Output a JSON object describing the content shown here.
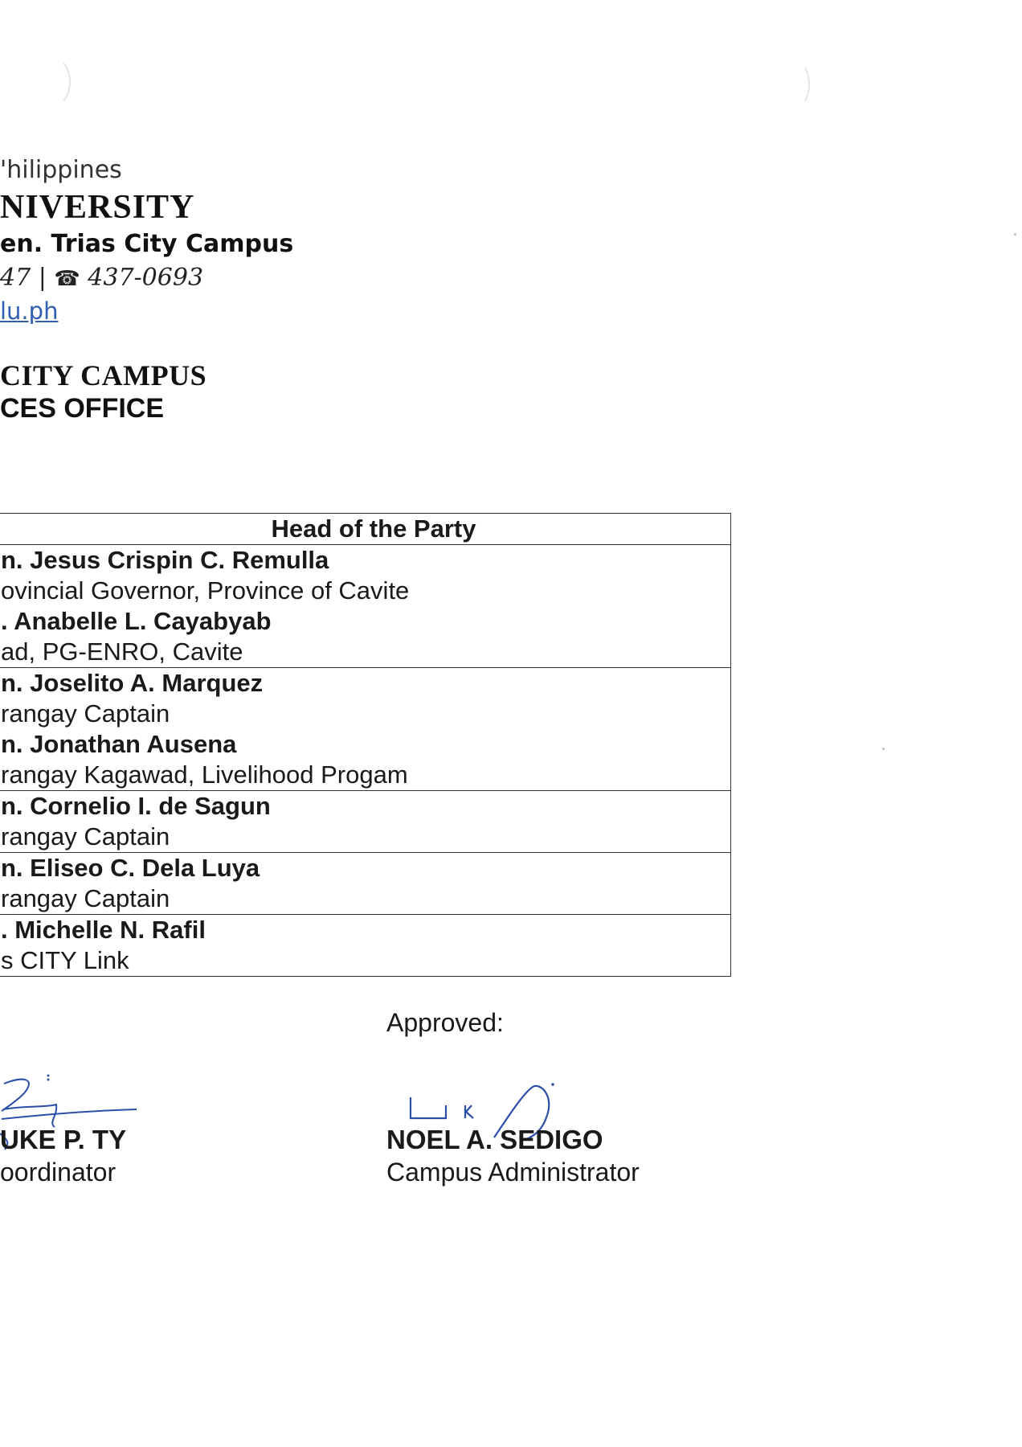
{
  "letterhead": {
    "country": "'hilippines",
    "university": "NIVERSITY",
    "campus": "en. Trias City Campus",
    "phone_left": "47 | ",
    "phone_right": " 437-0693",
    "phone_icon": "telephone-icon",
    "website": "lu.ph",
    "office_line1": "CITY CAMPUS",
    "office_line2": "CES OFFICE"
  },
  "table": {
    "header": "Head of the Party",
    "rows": [
      {
        "entries": [
          {
            "name": "n. Jesus Crispin C. Remulla",
            "position": "ovincial Governor, Province of Cavite"
          },
          {
            "name": ". Anabelle L. Cayabyab",
            "position": "ad, PG-ENRO, Cavite"
          }
        ]
      },
      {
        "entries": [
          {
            "name": "n. Joselito A. Marquez",
            "position": "rangay Captain"
          },
          {
            "name": "n. Jonathan Ausena",
            "position": "rangay Kagawad, Livelihood Progam"
          }
        ]
      },
      {
        "entries": [
          {
            "name": "n. Cornelio I. de Sagun",
            "position": "rangay Captain"
          }
        ]
      },
      {
        "entries": [
          {
            "name": "n. Eliseo C. Dela Luya",
            "position": "rangay Captain"
          }
        ]
      },
      {
        "entries": [
          {
            "name": ". Michelle N. Rafil",
            "position": "s CITY Link"
          }
        ]
      }
    ]
  },
  "approval": {
    "approved_label": "Approved:",
    "left_signatory": {
      "name": "UKE P. TY",
      "title": "oordinator"
    },
    "right_signatory": {
      "name": "NOEL A. SEDIGO",
      "title": "Campus Administrator"
    }
  },
  "colors": {
    "link": "#2f5fb3",
    "signature_ink": "#2b4fa8",
    "border": "#333333"
  }
}
